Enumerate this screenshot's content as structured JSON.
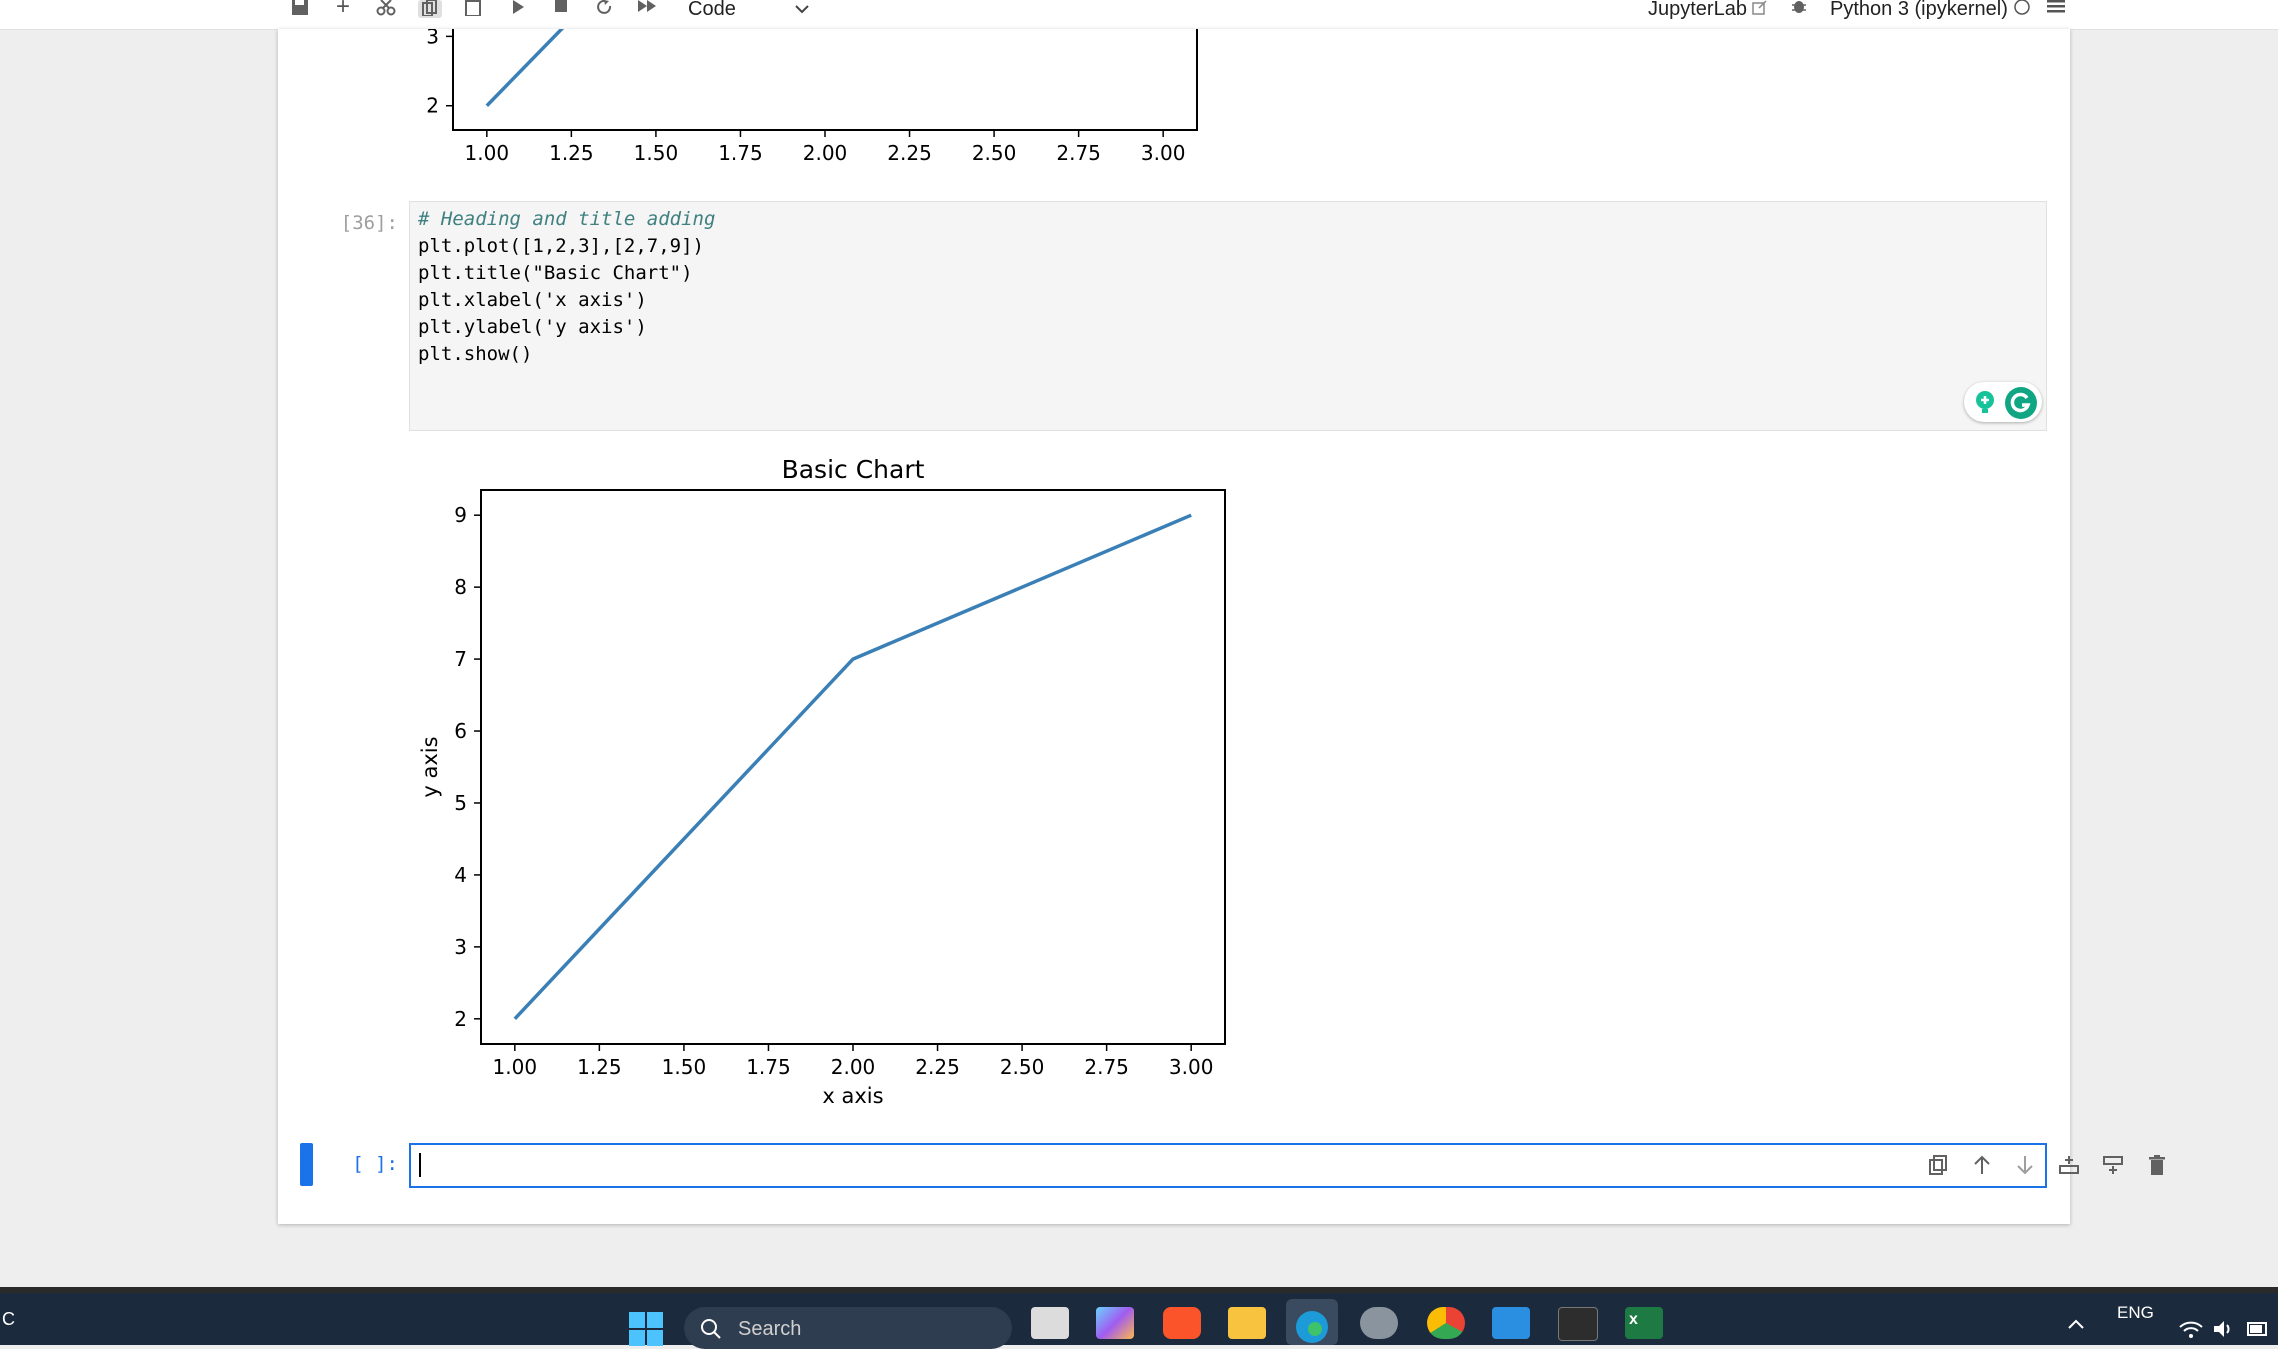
{
  "toolbar": {
    "cell_type": "Code",
    "right_label": "JupyterLab",
    "kernel": "Python 3 (ipykernel)"
  },
  "cells": {
    "prompt_36": "[36]:",
    "code_lines": [
      "# Heading and title adding",
      "plt.plot([1,2,3],[2,7,9])",
      "plt.title(\"Basic Chart\")",
      "plt.xlabel('x axis')",
      "plt.ylabel('y axis')",
      "plt.show()"
    ],
    "empty_prompt": "[ ]:"
  },
  "chart_data": [
    {
      "type": "line",
      "title": "",
      "xlabel": "",
      "ylabel": "",
      "x": [
        1,
        2,
        3
      ],
      "y": [
        2,
        7,
        9
      ],
      "xticks": [
        "1.00",
        "1.25",
        "1.50",
        "1.75",
        "2.00",
        "2.25",
        "2.50",
        "2.75",
        "3.00"
      ],
      "yticks": [
        "2",
        "3"
      ],
      "xlim": [
        0.9,
        3.1
      ],
      "ylim": [
        1.65,
        9.35
      ],
      "color": "#3a80b7",
      "partially_visible": true
    },
    {
      "type": "line",
      "title": "Basic Chart",
      "xlabel": "x axis",
      "ylabel": "y axis",
      "x": [
        1,
        2,
        3
      ],
      "y": [
        2,
        7,
        9
      ],
      "xticks": [
        "1.00",
        "1.25",
        "1.50",
        "1.75",
        "2.00",
        "2.25",
        "2.50",
        "2.75",
        "3.00"
      ],
      "yticks": [
        "2",
        "3",
        "4",
        "5",
        "6",
        "7",
        "8",
        "9"
      ],
      "xlim": [
        0.9,
        3.1
      ],
      "ylim": [
        1.65,
        9.35
      ],
      "color": "#3a80b7"
    }
  ],
  "taskbar": {
    "search_placeholder": "Search",
    "lang": "ENG",
    "left_text": "C"
  },
  "colors": {
    "accent": "#1a73e8",
    "line": "#3a80b7",
    "taskbar": "#1b2a3c"
  }
}
